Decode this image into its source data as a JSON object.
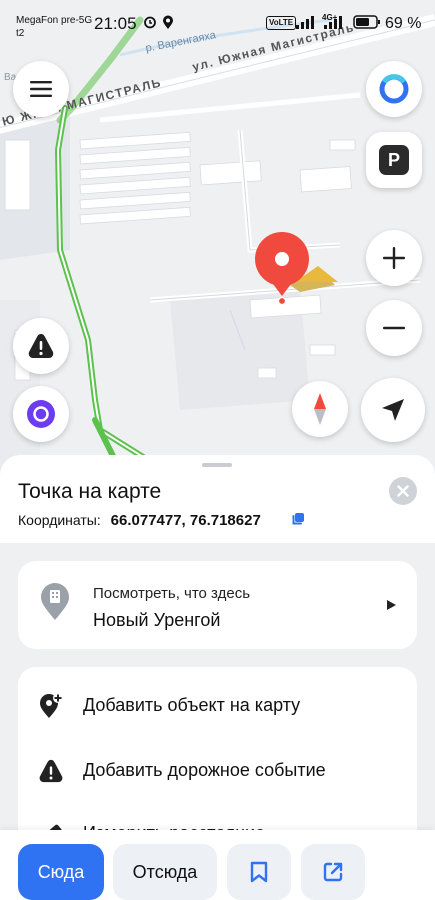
{
  "status_bar": {
    "carrier_line1": "MegaFon pre-5G",
    "carrier_line2": "t2",
    "time": "21:05",
    "network_badge": "VoLTE",
    "network_type": "4G+",
    "battery_percent": "69 %"
  },
  "map": {
    "street_label": "ул. Южная Магистраль",
    "street_label_left": "Ю ЖНАЯ МАГИСТРАЛЬ",
    "river_label": "р. Варенгаяха",
    "area_label": "Варе...",
    "icons": {
      "menu": "menu-icon",
      "assistant_top": "alice-assistant-icon",
      "parking": "parking-icon",
      "zoom_in": "plus-icon",
      "zoom_out": "minus-icon",
      "warning": "road-event-icon",
      "alice": "alice-icon",
      "compass": "compass-icon",
      "my_location": "navigation-arrow-icon"
    },
    "parking_letter": "P",
    "colors": {
      "route_green": "#5cc24d",
      "pin_red": "#f04a3e",
      "accent": "#2f73f2"
    }
  },
  "sheet": {
    "title": "Точка на карте",
    "coords_label": "Координаты:",
    "coords_value": "66.077477, 76.718627",
    "whats_here": {
      "title": "Посмотреть, что здесь",
      "subtitle": "Новый Уренгой"
    },
    "actions": [
      {
        "label": "Добавить объект на карту",
        "icon": "add-place-icon"
      },
      {
        "label": "Добавить дорожное событие",
        "icon": "warning-icon"
      },
      {
        "label": "Измерить расстояние",
        "icon": "ruler-icon"
      }
    ]
  },
  "bottom_bar": {
    "here_label": "Сюда",
    "from_label": "Отсюда",
    "bookmark_icon": "bookmark-icon",
    "share_icon": "share-icon"
  }
}
